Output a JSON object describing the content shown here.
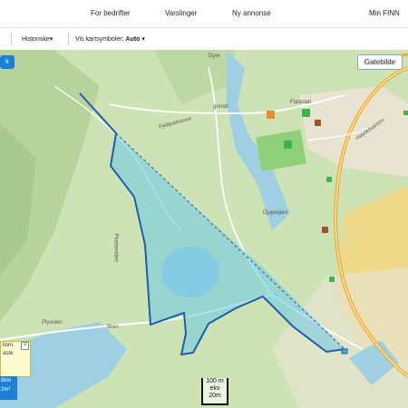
{
  "nav": {
    "for_business": "For bedrifter",
    "alerts": "Varslinger",
    "new_ad": "Ny annonse",
    "my_finn": "Min FINN"
  },
  "toolbar": {
    "historical": "Historiske",
    "historical_caret": "▾",
    "symbols_label": "Vis kartsymboler:",
    "symbols_value": "Auto",
    "symbols_caret": "▾"
  },
  "map": {
    "left_button": "k",
    "streetview_button": "Gatebilde",
    "popup_line1": "llom.",
    "popup_line2": "aste",
    "popup_close": "×",
    "measure_line1": "8km",
    "measure_line2": "2m²",
    "scale_line1": "100 m",
    "scale_line2": "ekv",
    "scale_line3": "20m",
    "place_labels": {
      "dyre": "Dyre",
      "fjellpark": "Fjellparkveien",
      "grendi": "grendi",
      "flatastoi": "Flatastøl",
      "djupetjern": "Djupetjern",
      "plussenden": "Plussenden",
      "bren": "Bren",
      "plyvolen": "Plyvolen",
      "hoydebakken": "Høydebakken"
    }
  },
  "colors": {
    "accent": "#1d7fd6",
    "polygon_fill": "#6ec9e6",
    "polygon_stroke": "#1f5ea8",
    "road": "#f3a92f"
  }
}
